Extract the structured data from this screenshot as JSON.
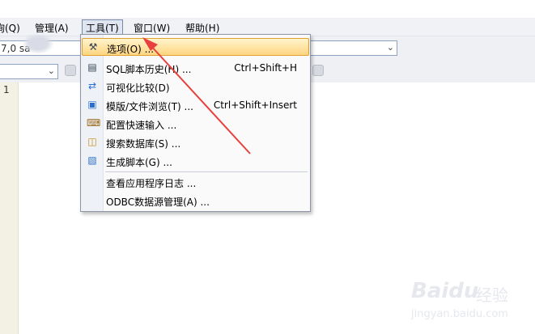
{
  "menubar": {
    "items": [
      {
        "label": "询(Q)"
      },
      {
        "label": "管理(A)"
      },
      {
        "label": "工具(T)"
      },
      {
        "label": "窗口(W)"
      },
      {
        "label": "帮助(H)"
      }
    ]
  },
  "toolbar": {
    "connection_value": "7,0     sa",
    "database_value": ""
  },
  "editor": {
    "line_number": "1"
  },
  "tools_menu": {
    "items": [
      {
        "label": "选项(O) ...",
        "icon": "wrench-screwdriver-icon",
        "shortcut": ""
      },
      {
        "label": "SQL脚本历史(H) ...",
        "icon": "sql-history-icon",
        "shortcut": "Ctrl+Shift+H"
      },
      {
        "label": "可视化比较(D)",
        "icon": "compare-icon",
        "shortcut": ""
      },
      {
        "label": "模版/文件浏览(T) ...",
        "icon": "template-browse-icon",
        "shortcut": "Ctrl+Shift+Insert"
      },
      {
        "label": "配置快速输入 ...",
        "icon": "quick-input-icon",
        "shortcut": ""
      },
      {
        "label": "搜索数据库(S) ...",
        "icon": "search-database-icon",
        "shortcut": ""
      },
      {
        "label": "生成脚本(G) ...",
        "icon": "generate-script-icon",
        "shortcut": ""
      },
      {
        "label": "查看应用程序日志 ...",
        "icon": "",
        "shortcut": ""
      },
      {
        "label": "ODBC数据源管理(A) ...",
        "icon": "",
        "shortcut": ""
      }
    ]
  },
  "annotation": {
    "arrow_color": "#e8403c"
  },
  "watermark": {
    "brand": "Baidu",
    "cn": "经验",
    "url": "jingyan.baidu.com"
  }
}
